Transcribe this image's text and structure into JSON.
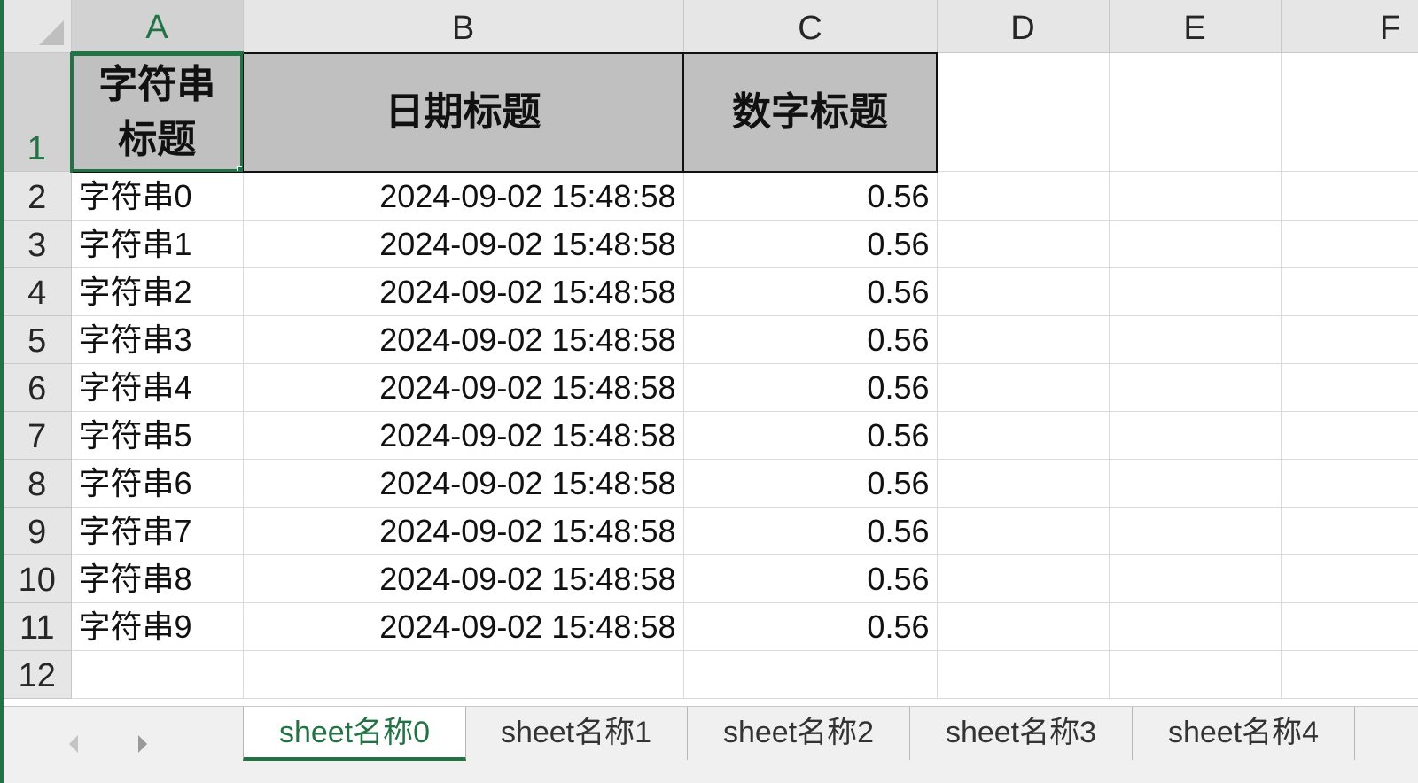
{
  "sheet": {
    "columns": [
      "A",
      "B",
      "C",
      "D",
      "E",
      "F"
    ],
    "row_numbers": [
      "1",
      "2",
      "3",
      "4",
      "5",
      "6",
      "7",
      "8",
      "9",
      "10",
      "11",
      "12"
    ],
    "headers": {
      "a_line1": "字符串",
      "a_line2": "标题",
      "b": "日期标题",
      "c": "数字标题"
    },
    "rows": [
      {
        "a": "字符串0",
        "b": "2024-09-02 15:48:58",
        "c": "0.56"
      },
      {
        "a": "字符串1",
        "b": "2024-09-02 15:48:58",
        "c": "0.56"
      },
      {
        "a": "字符串2",
        "b": "2024-09-02 15:48:58",
        "c": "0.56"
      },
      {
        "a": "字符串3",
        "b": "2024-09-02 15:48:58",
        "c": "0.56"
      },
      {
        "a": "字符串4",
        "b": "2024-09-02 15:48:58",
        "c": "0.56"
      },
      {
        "a": "字符串5",
        "b": "2024-09-02 15:48:58",
        "c": "0.56"
      },
      {
        "a": "字符串6",
        "b": "2024-09-02 15:48:58",
        "c": "0.56"
      },
      {
        "a": "字符串7",
        "b": "2024-09-02 15:48:58",
        "c": "0.56"
      },
      {
        "a": "字符串8",
        "b": "2024-09-02 15:48:58",
        "c": "0.56"
      },
      {
        "a": "字符串9",
        "b": "2024-09-02 15:48:58",
        "c": "0.56"
      }
    ],
    "selected_cell": "A1"
  },
  "tabs": [
    {
      "label": "sheet名称0",
      "active": true
    },
    {
      "label": "sheet名称1",
      "active": false
    },
    {
      "label": "sheet名称2",
      "active": false
    },
    {
      "label": "sheet名称3",
      "active": false
    },
    {
      "label": "sheet名称4",
      "active": false
    }
  ],
  "icons": {
    "prev": "chevron-left-icon",
    "next": "chevron-right-icon",
    "select_all": "select-all-triangle-icon"
  },
  "colors": {
    "accent": "#217346",
    "header_fill": "#c0c0c0",
    "heading_bg": "#e6e6e6"
  }
}
